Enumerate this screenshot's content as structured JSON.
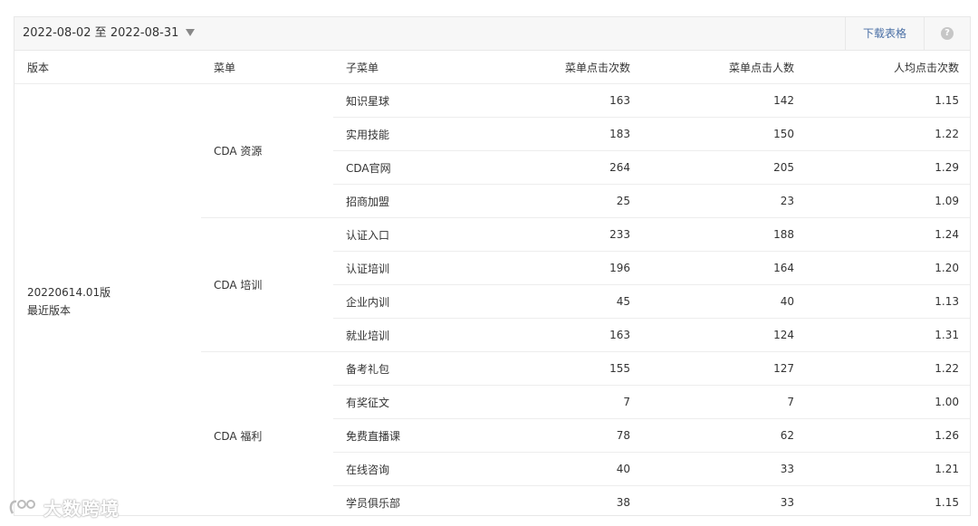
{
  "toolbar": {
    "date_range": "2022-08-02 至 2022-08-31",
    "download_label": "下载表格",
    "help_glyph": "?"
  },
  "table": {
    "headers": [
      "版本",
      "菜单",
      "子菜单",
      "菜单点击次数",
      "菜单点击人数",
      "人均点击次数"
    ],
    "version": {
      "line1": "20220614.01版",
      "line2": "最近版本"
    },
    "groups": [
      {
        "menu": "CDA 资源",
        "rows": [
          {
            "submenu": "知识星球",
            "clicks": "163",
            "users": "142",
            "avg": "1.15"
          },
          {
            "submenu": "实用技能",
            "clicks": "183",
            "users": "150",
            "avg": "1.22"
          },
          {
            "submenu": "CDA官网",
            "clicks": "264",
            "users": "205",
            "avg": "1.29"
          },
          {
            "submenu": "招商加盟",
            "clicks": "25",
            "users": "23",
            "avg": "1.09"
          }
        ]
      },
      {
        "menu": "CDA 培训",
        "rows": [
          {
            "submenu": "认证入口",
            "clicks": "233",
            "users": "188",
            "avg": "1.24"
          },
          {
            "submenu": "认证培训",
            "clicks": "196",
            "users": "164",
            "avg": "1.20"
          },
          {
            "submenu": "企业内训",
            "clicks": "45",
            "users": "40",
            "avg": "1.13"
          },
          {
            "submenu": "就业培训",
            "clicks": "163",
            "users": "124",
            "avg": "1.31"
          }
        ]
      },
      {
        "menu": "CDA 福利",
        "rows": [
          {
            "submenu": "备考礼包",
            "clicks": "155",
            "users": "127",
            "avg": "1.22"
          },
          {
            "submenu": "有奖征文",
            "clicks": "7",
            "users": "7",
            "avg": "1.00"
          },
          {
            "submenu": "免费直播课",
            "clicks": "78",
            "users": "62",
            "avg": "1.26"
          },
          {
            "submenu": "在线咨询",
            "clicks": "40",
            "users": "33",
            "avg": "1.21"
          },
          {
            "submenu": "学员俱乐部",
            "clicks": "38",
            "users": "33",
            "avg": "1.15"
          }
        ]
      }
    ]
  },
  "watermark": {
    "text": "大数跨境"
  }
}
